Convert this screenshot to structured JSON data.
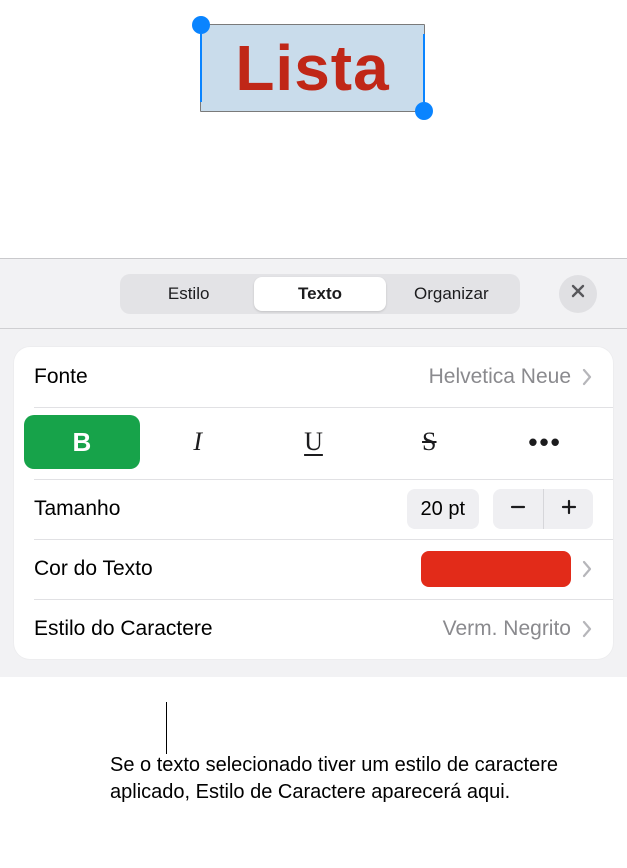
{
  "canvas": {
    "selected_text": "Lista",
    "text_color": "#c02717"
  },
  "tabs": {
    "items": [
      "Estilo",
      "Texto",
      "Organizar"
    ],
    "active_index": 1
  },
  "font_row": {
    "label": "Fonte",
    "value": "Helvetica Neue"
  },
  "bius": {
    "bold": "B",
    "italic": "I",
    "underline": "U",
    "strike": "S",
    "more": "•••",
    "active": "bold"
  },
  "size_row": {
    "label": "Tamanho",
    "value": "20 pt"
  },
  "color_row": {
    "label": "Cor do Texto",
    "swatch": "#e22b19"
  },
  "charstyle_row": {
    "label": "Estilo do Caractere",
    "value": "Verm. Negrito"
  },
  "callout": "Se o texto selecionado tiver um estilo de caractere aplicado, Estilo de Caractere aparecerá aqui."
}
